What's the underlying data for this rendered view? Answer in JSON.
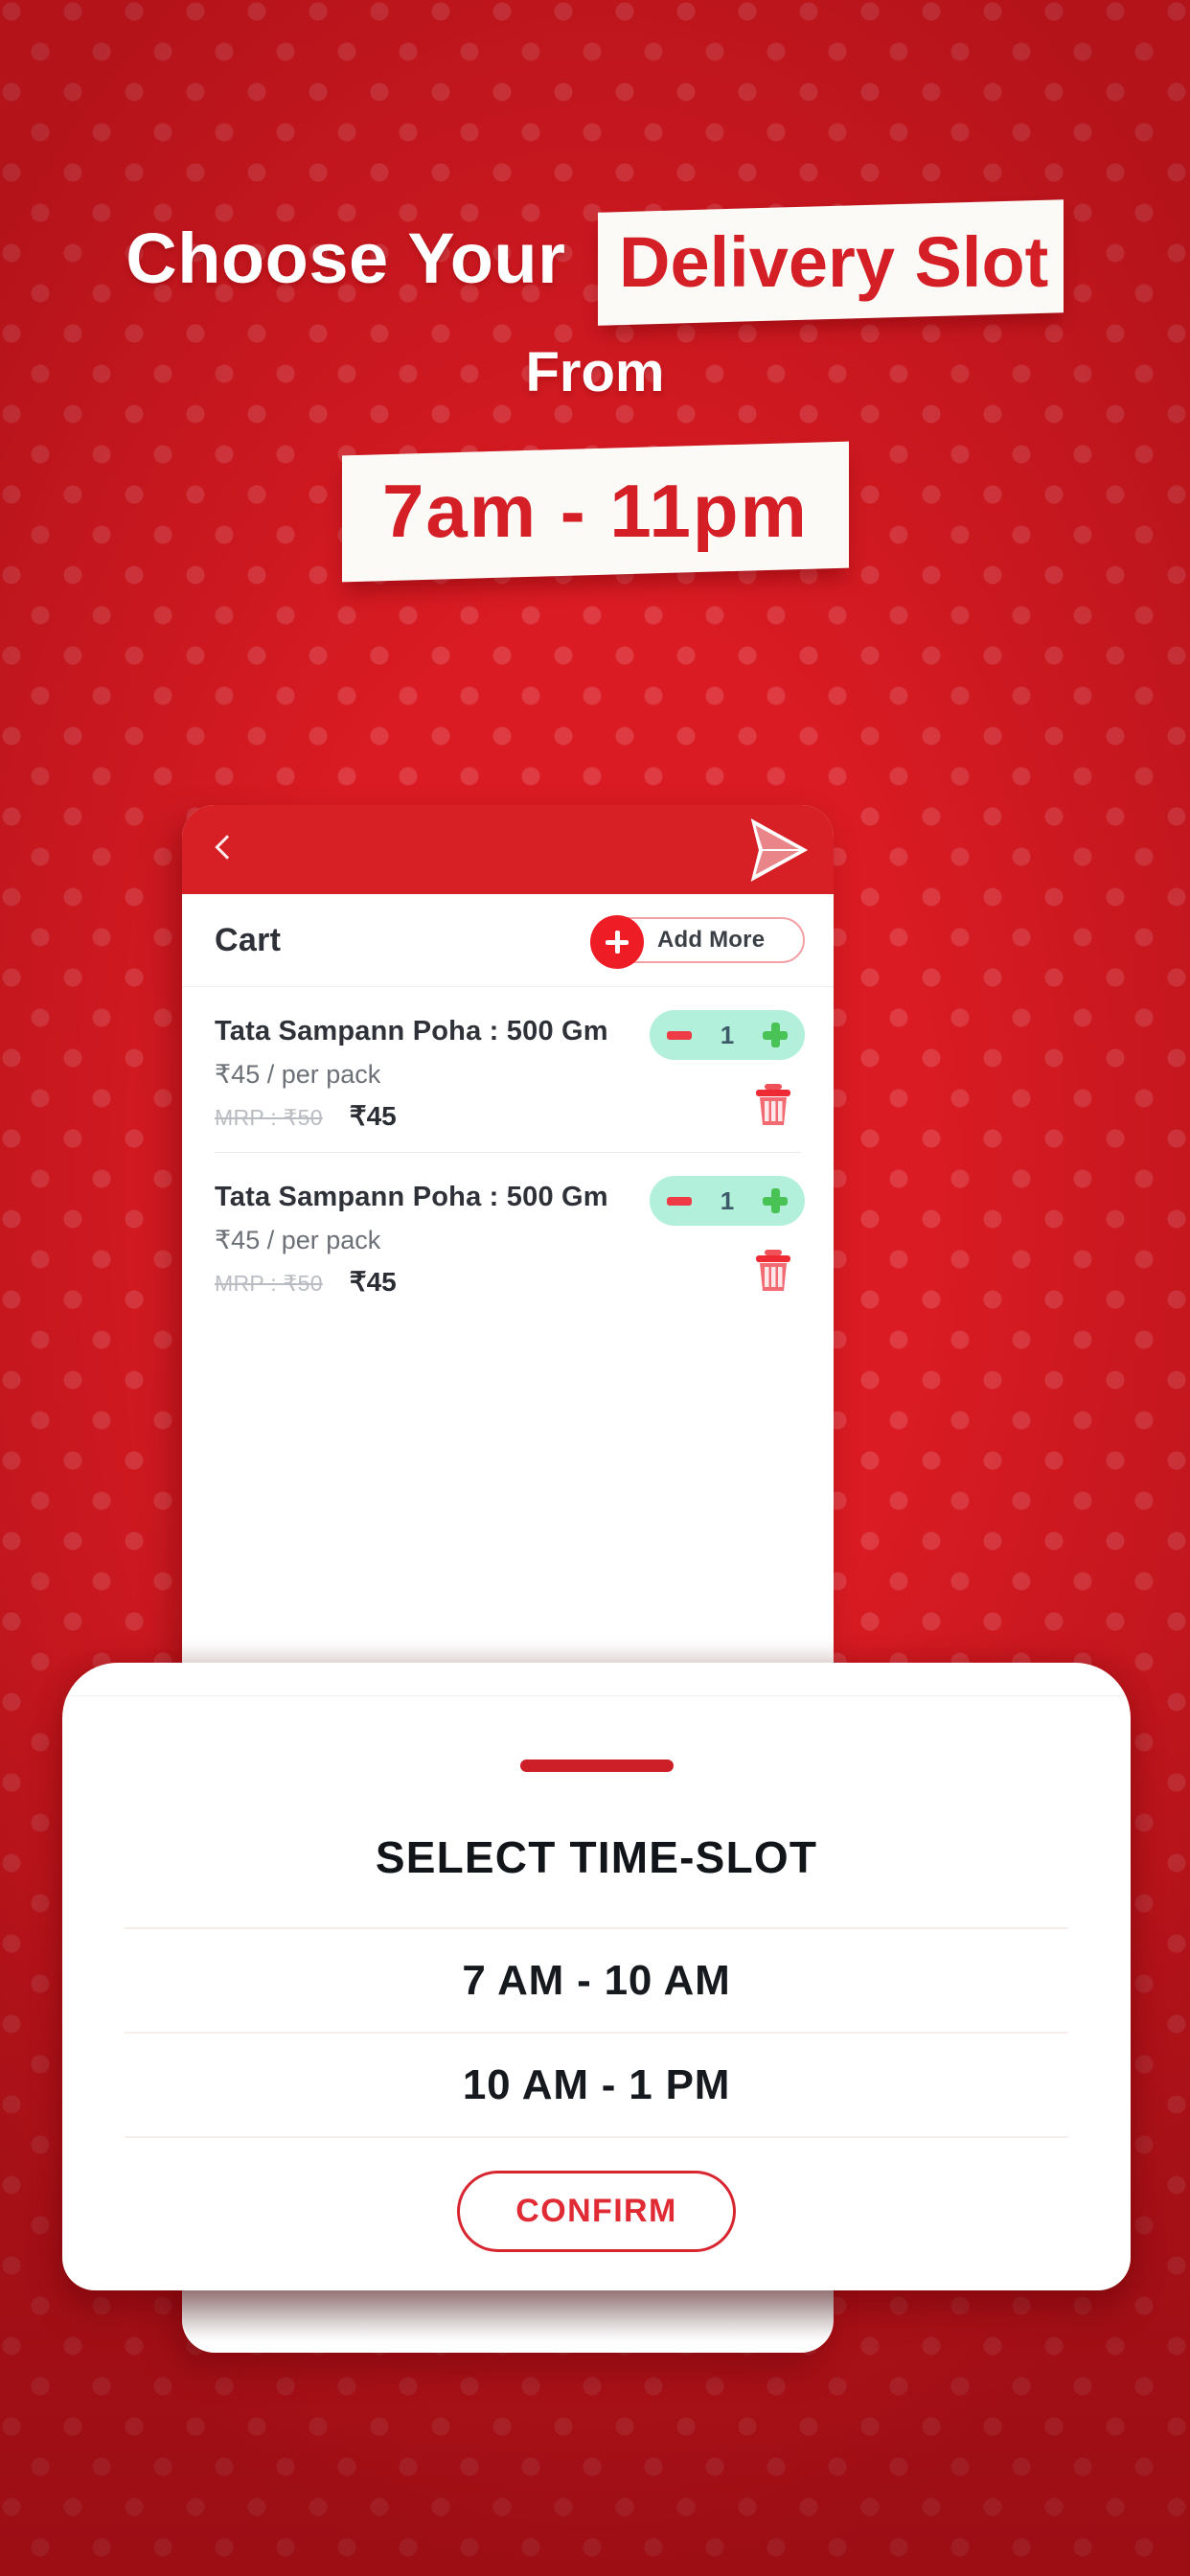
{
  "promo": {
    "line1_plain": "Choose Your",
    "line1_highlight": "Delivery Slot",
    "line2": "From",
    "line3": "7am - 11pm"
  },
  "colors": {
    "brand_red": "#DA1B23",
    "header_red": "#D71F26",
    "accent_red": "#EE1C25",
    "stepper_mint": "#B2F0DB",
    "plus_green": "#49C356",
    "text_dark": "#2e3138"
  },
  "phone": {
    "header": {
      "back_icon": "chevron-left-icon",
      "logo_icon": "paper-plane-logo-icon"
    },
    "cart": {
      "title": "Cart",
      "add_more_label": "Add More",
      "add_more_icon": "plus-circle-icon"
    },
    "items": [
      {
        "name": "Tata Sampann Poha : 500 Gm",
        "unit_price": "₹45 / per pack",
        "mrp": "MRP : ₹50",
        "price": "₹45",
        "qty": "1",
        "minus_icon": "minus-icon",
        "plus_icon": "plus-icon",
        "delete_icon": "trash-icon"
      },
      {
        "name": "Tata Sampann Poha : 500 Gm",
        "unit_price": "₹45 / per pack",
        "mrp": "MRP : ₹50",
        "price": "₹45",
        "qty": "1",
        "minus_icon": "minus-icon",
        "plus_icon": "plus-icon",
        "delete_icon": "trash-icon"
      }
    ]
  },
  "bottom_sheet": {
    "grabber_icon": "drag-handle-icon",
    "title": "SELECT TIME-SLOT",
    "slots": [
      {
        "label": "7 AM - 10 AM"
      },
      {
        "label": "10 AM - 1 PM"
      }
    ],
    "confirm_label": "CONFIRM"
  }
}
